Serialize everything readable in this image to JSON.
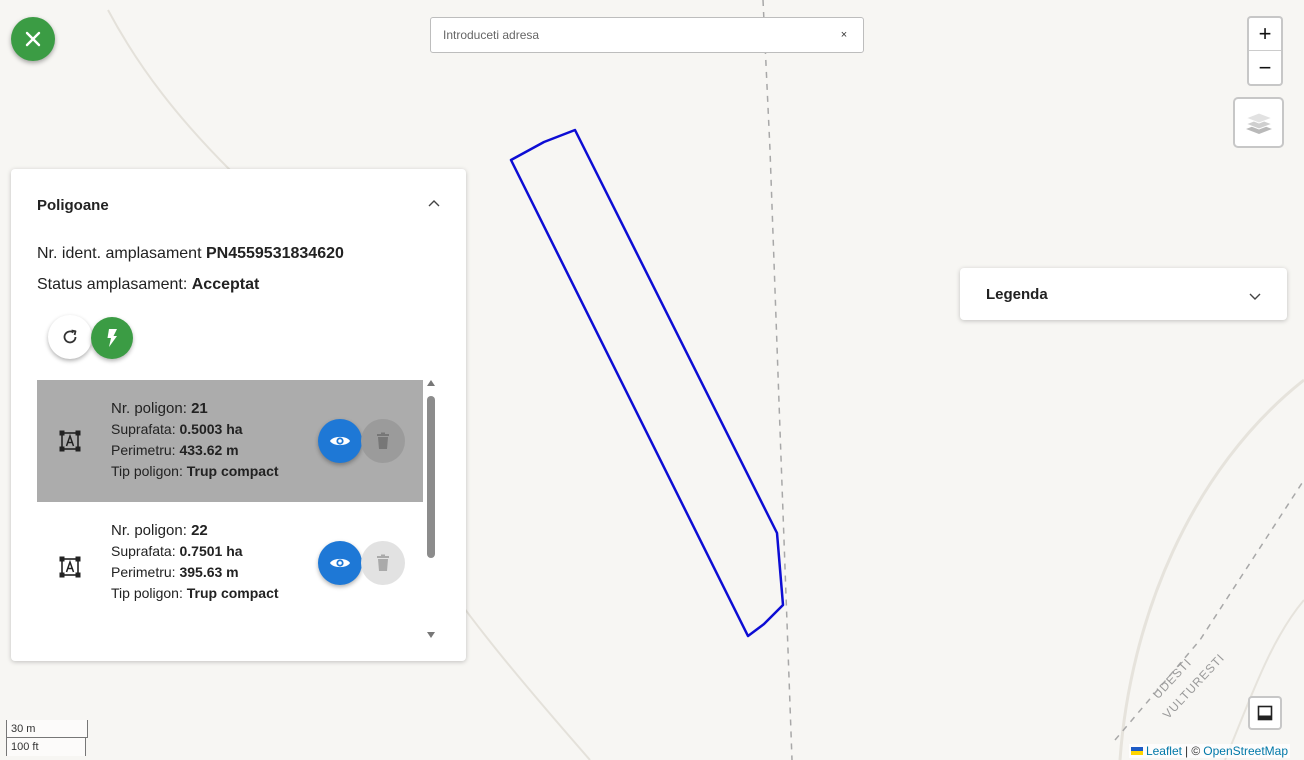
{
  "search": {
    "placeholder": "Introduceti adresa",
    "clear_glyph": "×"
  },
  "zoom": {
    "in": "+",
    "out": "−"
  },
  "panel": {
    "title": "Poligoane",
    "ident_label": "Nr. ident. amplasament",
    "ident_value": "PN4559531834620",
    "status_label": "Status amplasament:",
    "status_value": "Acceptat",
    "polygons": [
      {
        "nr_label": "Nr. poligon:",
        "nr_value": "21",
        "area_label": "Suprafata:",
        "area_value": "0.5003 ha",
        "perim_label": "Perimetru:",
        "perim_value": "433.62 m",
        "type_label": "Tip poligon:",
        "type_value": "Trup compact",
        "selected": true
      },
      {
        "nr_label": "Nr. poligon:",
        "nr_value": "22",
        "area_label": "Suprafata:",
        "area_value": "0.7501 ha",
        "perim_label": "Perimetru:",
        "perim_value": "395.63 m",
        "type_label": "Tip poligon:",
        "type_value": "Trup compact",
        "selected": false
      }
    ]
  },
  "legend": {
    "title": "Legenda"
  },
  "scale": {
    "metric": "30 m",
    "imperial": "100 ft"
  },
  "attribution": {
    "leaflet": "Leaflet",
    "separator": "| ©",
    "osm": "OpenStreetMap"
  },
  "map": {
    "place_label_1": "UDESTI",
    "place_label_2": "VULTURESTI"
  },
  "colors": {
    "polygon": "#0d0dd4",
    "accent_green": "#3b9c44",
    "eye_blue": "#1e78d6",
    "selected_row": "#acacac"
  },
  "icons": [
    "close-icon",
    "refresh-icon",
    "bolt-icon",
    "polygon-icon",
    "eye-icon",
    "trash-icon",
    "layers-icon",
    "chevron-up-icon",
    "chevron-down-icon",
    "ruler-icon"
  ]
}
